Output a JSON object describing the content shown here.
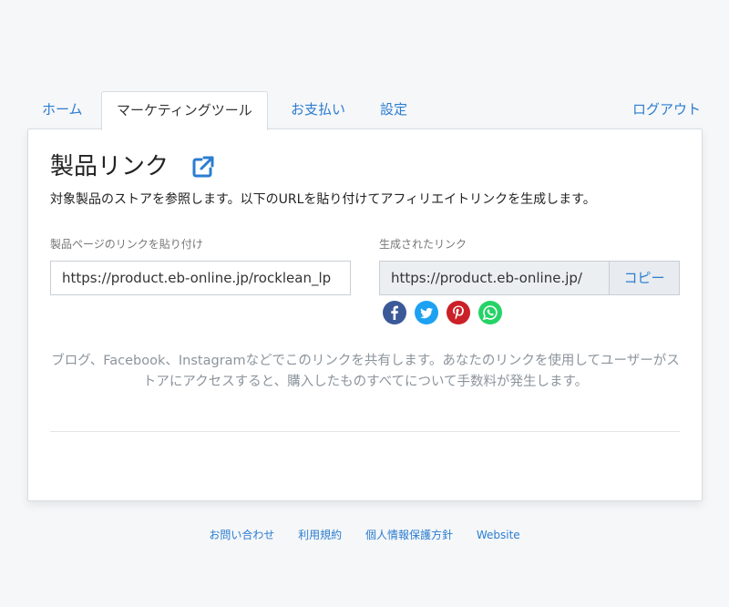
{
  "tabs": {
    "home": "ホーム",
    "marketing": "マーケティングツール",
    "payment": "お支払い",
    "settings": "設定",
    "logout": "ログアウト"
  },
  "main": {
    "title": "製品リンク",
    "description": "対象製品のストアを参照します。以下のURLを貼り付けてアフィリエイトリンクを生成します。",
    "product_link_label": "製品ページのリンクを貼り付け",
    "product_link_value": "https://product.eb-online.jp/rocklean_lp",
    "generated_label": "生成されたリンク",
    "generated_value": "https://product.eb-online.jp/",
    "copy_label": "コピー",
    "social_icons": [
      "facebook-icon",
      "twitter-icon",
      "pinterest-icon",
      "whatsapp-icon"
    ],
    "note": "ブログ、Facebook、Instagramなどでこのリンクを共有します。あなたのリンクを使用してユーザーがストアにアクセスすると、購入したものすべてについて手数料が発生します。"
  },
  "footer": {
    "contact": "お問い合わせ",
    "terms": "利用規約",
    "privacy": "個人情報保護方針",
    "website": "Website"
  },
  "colors": {
    "accent": "#2b7dd0",
    "facebook": "#3b5998",
    "twitter": "#1da1f2",
    "pinterest": "#cb2027",
    "whatsapp": "#25d366"
  }
}
